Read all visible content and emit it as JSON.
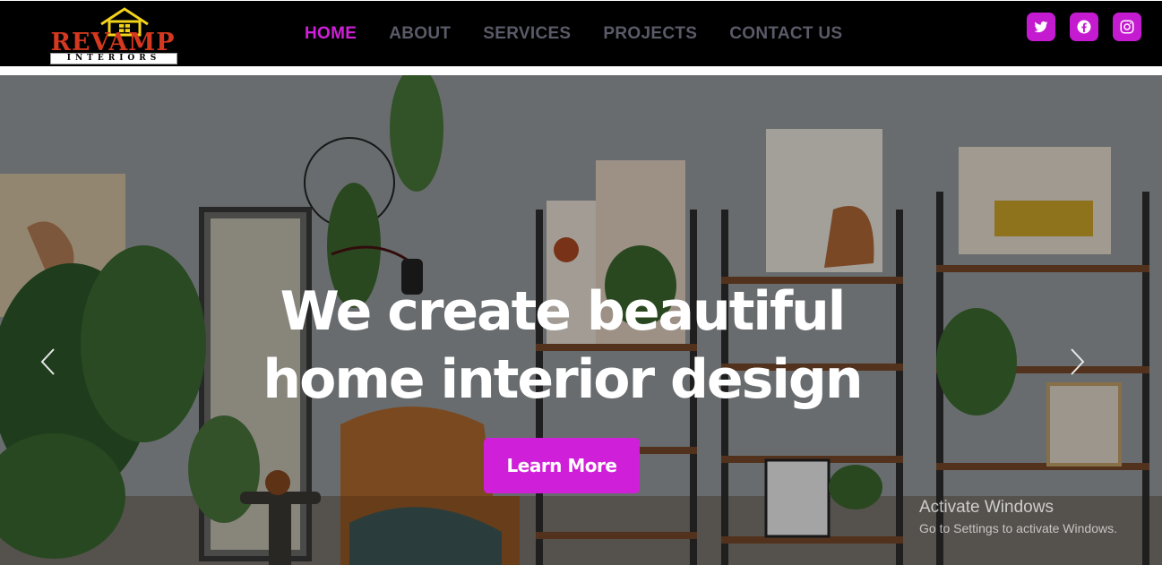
{
  "brand": {
    "name": "REVAMP",
    "tagline": "INTERIORS"
  },
  "nav": {
    "items": [
      {
        "label": "HOME",
        "active": true
      },
      {
        "label": "ABOUT",
        "active": false
      },
      {
        "label": "SERVICES",
        "active": false
      },
      {
        "label": "PROJECTS",
        "active": false
      },
      {
        "label": "CONTACT US",
        "active": false
      }
    ]
  },
  "social": [
    {
      "icon": "twitter-icon"
    },
    {
      "icon": "facebook-icon"
    },
    {
      "icon": "instagram-icon"
    }
  ],
  "hero": {
    "headline_line1": "We create beautiful",
    "headline_line2": "home interior design",
    "cta_label": "Learn More",
    "prev_icon": "chevron-left-icon",
    "next_icon": "chevron-right-icon"
  },
  "os_watermark": {
    "title": "Activate Windows",
    "subtitle": "Go to Settings to activate Windows."
  },
  "colors": {
    "accent": "#d01fd8",
    "header_bg": "#000000",
    "nav_text": "#5a5a68"
  }
}
